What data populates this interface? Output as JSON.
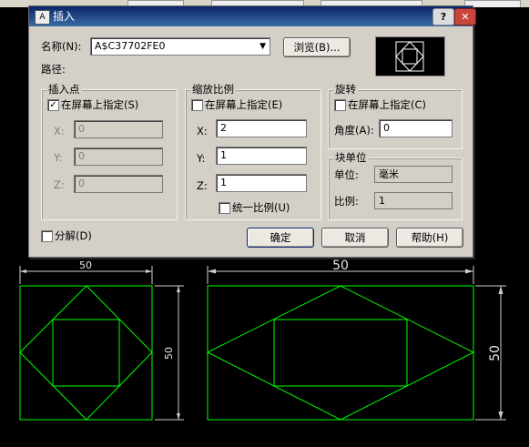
{
  "dialog": {
    "title": "插入",
    "title_icon": "A",
    "help_button": "?",
    "close_button": "✕",
    "name_label": "名称(N):",
    "name_value": "A$C37702FE0",
    "browse_button": "浏览(B)...",
    "path_label": "路径:",
    "insertion": {
      "title": "插入点",
      "specify_on_screen": "在屏幕上指定(S)",
      "specify_checked": true,
      "x_label": "X:",
      "x_value": "0",
      "y_label": "Y:",
      "y_value": "0",
      "z_label": "Z:",
      "z_value": "0"
    },
    "scale": {
      "title": "缩放比例",
      "specify_on_screen": "在屏幕上指定(E)",
      "specify_checked": false,
      "x_label": "X:",
      "x_value": "2",
      "y_label": "Y:",
      "y_value": "1",
      "z_label": "Z:",
      "z_value": "1",
      "uniform_label": "统一比例(U)",
      "uniform_checked": false
    },
    "rotation": {
      "title": "旋转",
      "specify_on_screen": "在屏幕上指定(C)",
      "specify_checked": false,
      "angle_label": "角度(A):",
      "angle_value": "0"
    },
    "block_unit": {
      "title": "块单位",
      "unit_label": "单位:",
      "unit_value": "毫米",
      "factor_label": "比例:",
      "factor_value": "1"
    },
    "explode_label": "分解(D)",
    "explode_checked": false,
    "ok_button": "确定",
    "cancel_button": "取消",
    "help_bottom_button": "帮助(H)"
  },
  "drawing": {
    "left_dim_top": "50",
    "left_dim_side": "50",
    "right_dim_top": "50",
    "right_dim_side": "50",
    "line_color": "#00ff00",
    "dim_color": "#ffffff"
  }
}
